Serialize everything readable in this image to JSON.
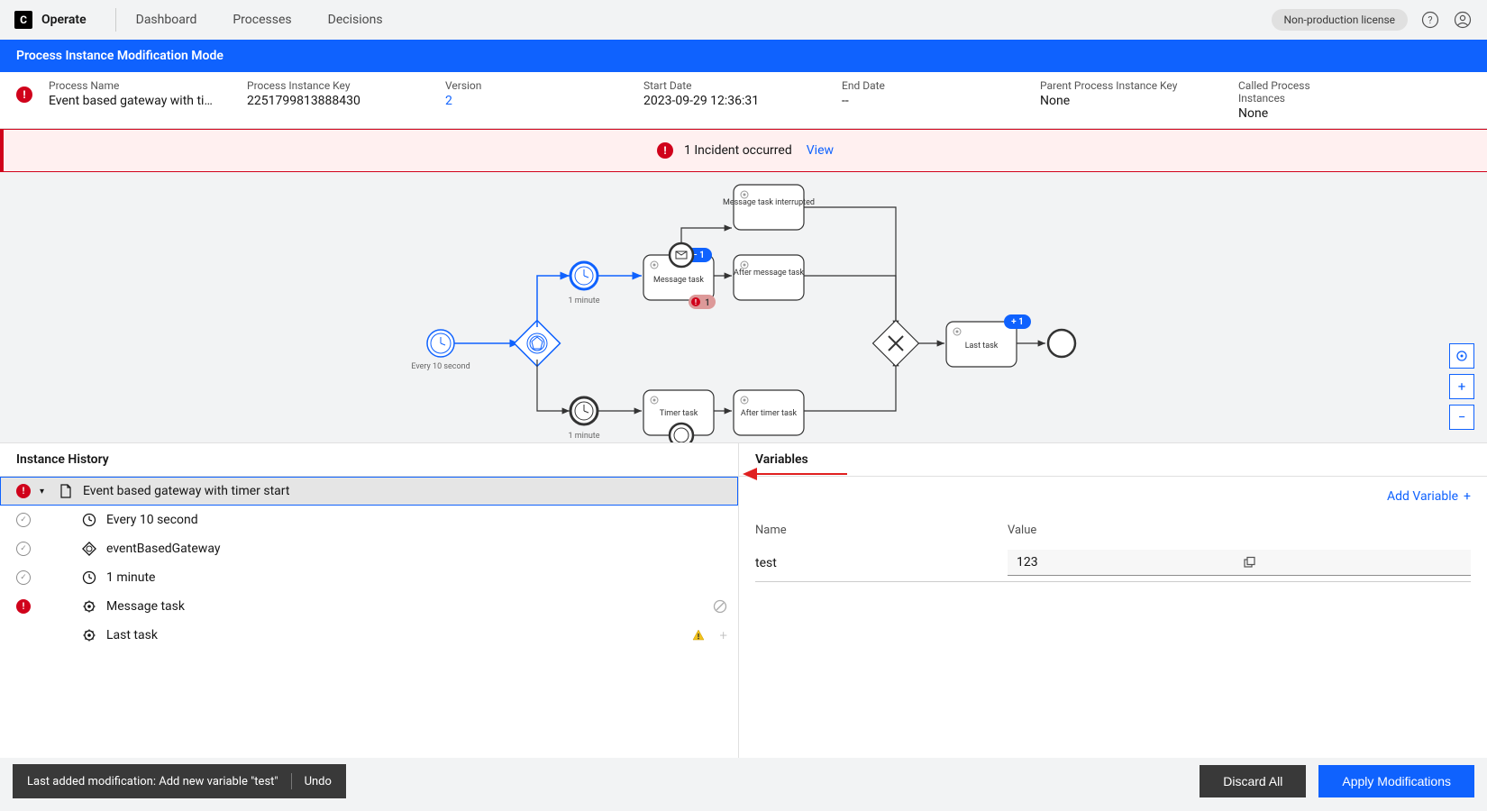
{
  "header": {
    "app_name": "Operate",
    "nav": {
      "dashboard": "Dashboard",
      "processes": "Processes",
      "decisions": "Decisions"
    },
    "license": "Non-production license"
  },
  "mod_banner": "Process Instance Modification Mode",
  "info": {
    "process_name": {
      "label": "Process Name",
      "value": "Event based gateway with timer …"
    },
    "process_key": {
      "label": "Process Instance Key",
      "value": "2251799813888430"
    },
    "version": {
      "label": "Version",
      "value": "2"
    },
    "start_date": {
      "label": "Start Date",
      "value": "2023-09-29 12:36:31"
    },
    "end_date": {
      "label": "End Date",
      "value": "--"
    },
    "parent_key": {
      "label": "Parent Process Instance Key",
      "value": "None"
    },
    "called": {
      "label": "Called Process Instances",
      "value": "None"
    }
  },
  "incident_banner": {
    "text": "1 Incident occurred",
    "view": "View"
  },
  "diagram": {
    "start_label": "Every 10 second",
    "timer1_label": "1 minute",
    "timer2_label": "1 minute",
    "msg_task_interrupted": "Message task interrupted",
    "msg_task": "Message task",
    "after_msg_task": "After message task",
    "timer_task": "Timer task",
    "after_timer_task": "After timer task",
    "last_task": "Last task",
    "badge_minus": "− 1",
    "badge_plus": "+ 1",
    "badge_one": "1"
  },
  "panels": {
    "history_title": "Instance History",
    "variables_title": "Variables",
    "add_variable": "Add Variable",
    "var_headers": {
      "name": "Name",
      "value": "Value"
    },
    "vars": [
      {
        "name": "test",
        "value": "123"
      }
    ],
    "history": [
      {
        "status": "incident",
        "label": "Event based gateway with timer start",
        "selected": true,
        "expandable": true,
        "icon": "doc"
      },
      {
        "status": "ok",
        "label": "Every 10 second",
        "icon": "timer"
      },
      {
        "status": "ok",
        "label": "eventBasedGateway",
        "icon": "gateway"
      },
      {
        "status": "ok",
        "label": "1 minute",
        "icon": "timer"
      },
      {
        "status": "incident",
        "label": "Message task",
        "icon": "gear",
        "action_icon": "cancel"
      },
      {
        "status": "",
        "label": "Last task",
        "icon": "gear",
        "action_icon": "warning"
      }
    ]
  },
  "toast": {
    "text": "Last added modification: Add new variable \"test\"",
    "undo": "Undo"
  },
  "buttons": {
    "discard": "Discard All",
    "apply": "Apply Modifications"
  }
}
